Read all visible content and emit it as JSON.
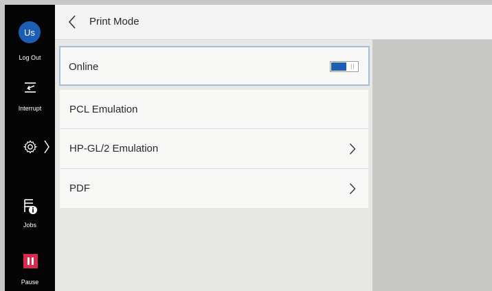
{
  "sidebar": {
    "avatar_text": "Us",
    "logout_label": "Log Out",
    "interrupt_label": "Interrupt",
    "jobs_label": "Jobs",
    "pause_label": "Pause",
    "pause_color": "#d92b4c"
  },
  "header": {
    "title": "Print Mode"
  },
  "menu": {
    "online": {
      "label": "Online",
      "toggle_on": true
    },
    "items": [
      {
        "label": "PCL Emulation",
        "has_chevron": false
      },
      {
        "label": "HP-GL/2 Emulation",
        "has_chevron": true
      },
      {
        "label": "PDF",
        "has_chevron": true
      }
    ]
  },
  "colors": {
    "accent": "#1a5fb4",
    "focus_border": "#a9badb"
  }
}
